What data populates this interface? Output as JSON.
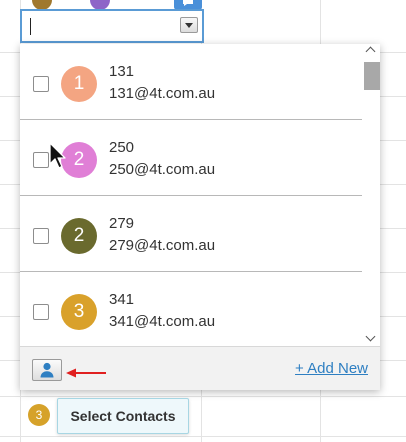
{
  "background_badge": {
    "label": "3",
    "color": "#d6a22a"
  },
  "top_chips": [
    {
      "color": "#a0782e"
    },
    {
      "color": "#8e65c8"
    }
  ],
  "search": {
    "value": ""
  },
  "contacts": [
    {
      "initial": "1",
      "name": "131",
      "email": "131@4t.com.au",
      "color": "#f4a582",
      "checked": false
    },
    {
      "initial": "2",
      "name": "250",
      "email": "250@4t.com.au",
      "color": "#e07fd6",
      "checked": false
    },
    {
      "initial": "2",
      "name": "279",
      "email": "279@4t.com.au",
      "color": "#6a6a2e",
      "checked": false
    },
    {
      "initial": "3",
      "name": "341",
      "email": "341@4t.com.au",
      "color": "#d9a12b",
      "checked": false
    }
  ],
  "footer": {
    "add_new_label": "+ Add New"
  },
  "tooltip": {
    "text": "Select Contacts"
  },
  "colors": {
    "accent": "#2e7fc2",
    "arrow": "#e02020",
    "contact_icon": "#2e7fc2"
  }
}
